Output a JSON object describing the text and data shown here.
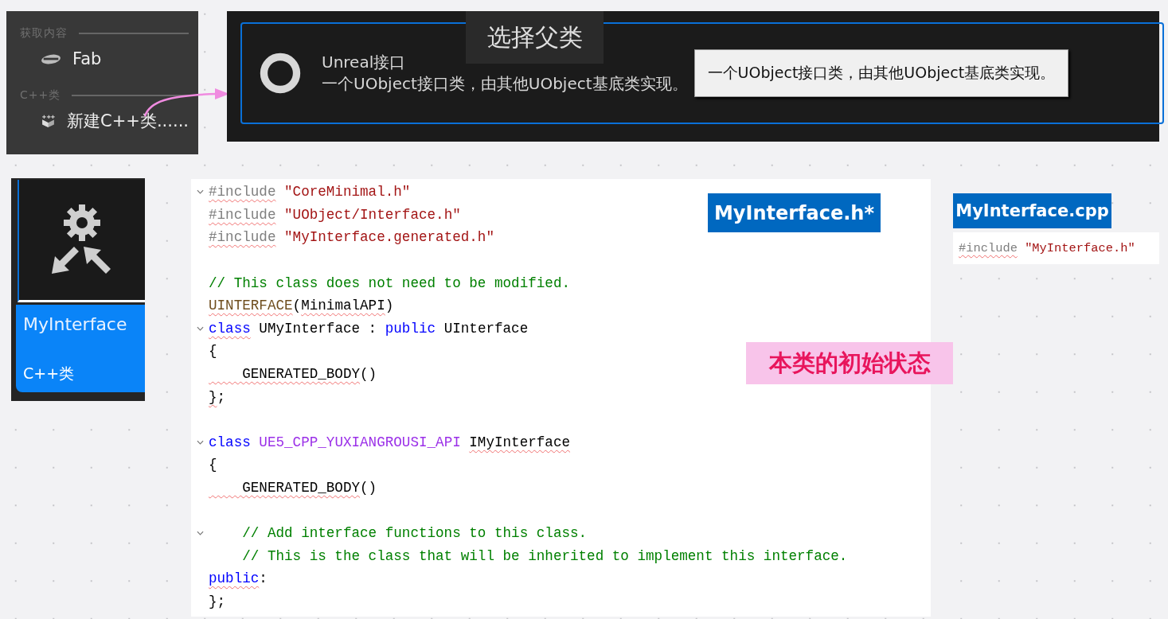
{
  "menu": {
    "sections": [
      {
        "heading": "获取内容",
        "items": [
          {
            "label": "Fab"
          }
        ]
      },
      {
        "heading": "C++类",
        "items": [
          {
            "label": "新建C++类......"
          }
        ]
      }
    ]
  },
  "parent_class_dialog": {
    "title": "选择父类",
    "option": {
      "name": "Unreal接口",
      "description": "一个UObject接口类，由其他UObject基底类实现。"
    },
    "tooltip": "一个UObject接口类，由其他UObject基底类实现。"
  },
  "asset_tile": {
    "name": "MyInterface",
    "type": "C++类"
  },
  "header_file": {
    "tab": "MyInterface.h*",
    "lines": [
      {
        "fold": true,
        "tokens": [
          {
            "text": "#include",
            "kind": "preproc",
            "squiggle": true
          },
          {
            "text": " \"CoreMinimal.h\"",
            "kind": "string",
            "squiggle": false
          }
        ]
      },
      {
        "fold": false,
        "tokens": [
          {
            "text": "#include",
            "kind": "preproc",
            "squiggle": true
          },
          {
            "text": " \"UObject/Interface.h\"",
            "kind": "string",
            "squiggle": false
          }
        ]
      },
      {
        "fold": false,
        "tokens": [
          {
            "text": "#include",
            "kind": "preproc",
            "squiggle": true
          },
          {
            "text": " \"MyInterface.generated.h\"",
            "kind": "string",
            "squiggle": false
          }
        ]
      },
      {
        "fold": false
      },
      {
        "fold": false,
        "tokens": [
          {
            "text": "// This class does not need to be modified.",
            "kind": "comment",
            "squiggle": false
          }
        ]
      },
      {
        "fold": false,
        "tokens": [
          {
            "text": "UINTERFACE",
            "kind": "macro",
            "squiggle": true
          },
          {
            "text": "(",
            "kind": "plain",
            "squiggle": false
          },
          {
            "text": "MinimalAPI",
            "kind": "plain",
            "squiggle": true
          },
          {
            "text": ")",
            "kind": "plain",
            "squiggle": false
          }
        ]
      },
      {
        "fold": true,
        "tokens": [
          {
            "text": "class",
            "kind": "keyword",
            "squiggle": true
          },
          {
            "text": " UMyInterface : ",
            "kind": "plain",
            "squiggle": false
          },
          {
            "text": "public",
            "kind": "keyword",
            "squiggle": false
          },
          {
            "text": " UInterface",
            "kind": "plain",
            "squiggle": false
          }
        ]
      },
      {
        "fold": false,
        "tokens": [
          {
            "text": "{",
            "kind": "plain",
            "squiggle": false
          }
        ]
      },
      {
        "fold": false,
        "tokens": [
          {
            "text": "    GENERATED_BODY",
            "kind": "plain",
            "squiggle": true
          },
          {
            "text": "()",
            "kind": "plain",
            "squiggle": false
          }
        ]
      },
      {
        "fold": false,
        "tokens": [
          {
            "text": "}",
            "kind": "plain",
            "squiggle": true
          },
          {
            "text": ";",
            "kind": "plain",
            "squiggle": false
          }
        ]
      },
      {
        "fold": false
      },
      {
        "fold": true,
        "tokens": [
          {
            "text": "class",
            "kind": "keyword",
            "squiggle": false
          },
          {
            "text": " UE5_CPP_YUXIANGROUSI_API ",
            "kind": "api",
            "squiggle": false
          },
          {
            "text": "IMyInterface",
            "kind": "plain",
            "squiggle": true
          }
        ]
      },
      {
        "fold": false,
        "tokens": [
          {
            "text": "{",
            "kind": "plain",
            "squiggle": false
          }
        ]
      },
      {
        "fold": false,
        "tokens": [
          {
            "text": "    GENERATED_BODY",
            "kind": "plain",
            "squiggle": true
          },
          {
            "text": "()",
            "kind": "plain",
            "squiggle": false
          }
        ]
      },
      {
        "fold": false
      },
      {
        "fold": true,
        "tokens": [
          {
            "text": "    // Add interface functions to this class.",
            "kind": "comment",
            "squiggle": false
          }
        ]
      },
      {
        "fold": false,
        "tokens": [
          {
            "text": "    // This is the class that will be inherited to implement this interface.",
            "kind": "comment",
            "squiggle": false
          }
        ]
      },
      {
        "fold": false,
        "tokens": [
          {
            "text": "public",
            "kind": "keyword",
            "squiggle": true
          },
          {
            "text": ":",
            "kind": "plain",
            "squiggle": false
          }
        ]
      },
      {
        "fold": false,
        "tokens": [
          {
            "text": "};",
            "kind": "plain",
            "squiggle": false
          }
        ]
      }
    ]
  },
  "note": "本类的初始状态",
  "cpp_file": {
    "tab": "MyInterface.cpp",
    "lines": [
      {
        "fold": false,
        "tokens": [
          {
            "text": "#include",
            "kind": "preproc",
            "squiggle": true
          },
          {
            "text": " \"MyInterface.h\"",
            "kind": "string",
            "squiggle": false
          }
        ]
      }
    ]
  }
}
